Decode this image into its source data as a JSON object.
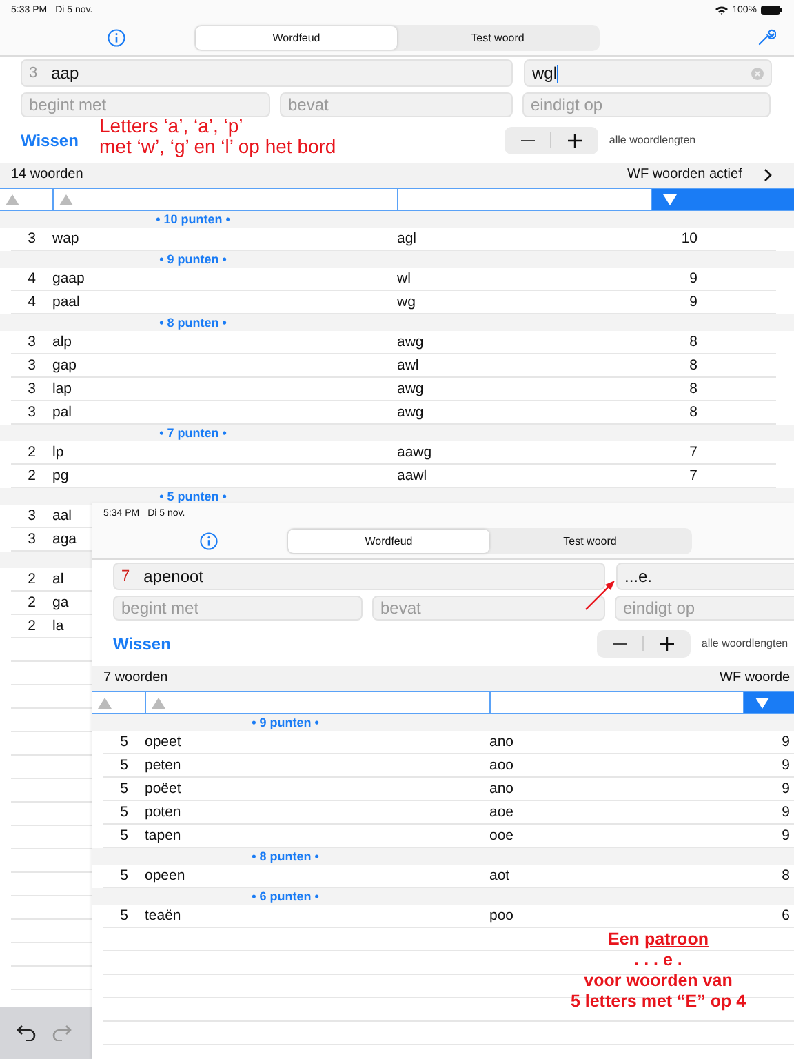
{
  "screens": [
    {
      "status_bar": {
        "time": "5:33 PM",
        "date": "Di 5 nov.",
        "battery": "100%"
      },
      "segments": [
        {
          "label": "Wordfeud",
          "selected": true
        },
        {
          "label": "Test woord",
          "selected": false
        }
      ],
      "letters_field": {
        "count": "3",
        "value": "aap",
        "alert": false
      },
      "board_field": {
        "value": "wgl",
        "focused": true
      },
      "filters": [
        {
          "placeholder": "begint met"
        },
        {
          "placeholder": "bevat"
        },
        {
          "placeholder": "eindigt op"
        }
      ],
      "clear_button": "Wissen",
      "length_label": "alle woordlengten",
      "result_count": "14 woorden",
      "wf_label": "WF woorden actief",
      "columns": [
        {
          "kind": "up",
          "selected": false
        },
        {
          "kind": "up",
          "selected": false
        },
        {
          "kind": "none",
          "selected": false
        },
        {
          "kind": "down",
          "selected": true
        }
      ],
      "rows": [
        {
          "kind": "section",
          "label": "• 10 punten •"
        },
        {
          "kind": "word",
          "length": "3",
          "word": "wap",
          "letters": "agl",
          "points": "10"
        },
        {
          "kind": "section",
          "label": "• 9 punten •"
        },
        {
          "kind": "word",
          "length": "4",
          "word": "gaap",
          "letters": "wl",
          "points": "9"
        },
        {
          "kind": "word",
          "length": "4",
          "word": "paal",
          "letters": "wg",
          "points": "9"
        },
        {
          "kind": "section",
          "label": "• 8 punten •"
        },
        {
          "kind": "word",
          "length": "3",
          "word": "alp",
          "letters": "awg",
          "points": "8"
        },
        {
          "kind": "word",
          "length": "3",
          "word": "gap",
          "letters": "awl",
          "points": "8"
        },
        {
          "kind": "word",
          "length": "3",
          "word": "lap",
          "letters": "awg",
          "points": "8"
        },
        {
          "kind": "word",
          "length": "3",
          "word": "pal",
          "letters": "awg",
          "points": "8"
        },
        {
          "kind": "section",
          "label": "• 7 punten •"
        },
        {
          "kind": "word",
          "length": "2",
          "word": "lp",
          "letters": "aawg",
          "points": "7"
        },
        {
          "kind": "word",
          "length": "2",
          "word": "pg",
          "letters": "aawl",
          "points": "7"
        },
        {
          "kind": "section",
          "label": "• 5 punten •"
        },
        {
          "kind": "word",
          "length": "3",
          "word": "aal"
        },
        {
          "kind": "word",
          "length": "3",
          "word": "aga"
        },
        {
          "kind": "section"
        },
        {
          "kind": "word",
          "length": "2",
          "word": "al"
        },
        {
          "kind": "word",
          "length": "2",
          "word": "ga"
        },
        {
          "kind": "word",
          "length": "2",
          "word": "la"
        }
      ],
      "annotation": "Letters ‘a’, ‘a’, ‘p’\nmet ‘w’, ‘g’ en ‘l’ op het bord",
      "edit_toolbar": true
    },
    {
      "status_bar": {
        "time": "5:34 PM",
        "date": "Di 5 nov."
      },
      "segments": [
        {
          "label": "Wordfeud",
          "selected": true
        },
        {
          "label": "Test woord",
          "selected": false
        }
      ],
      "letters_field": {
        "count": "7",
        "value": "apenoot",
        "alert": true
      },
      "board_field": {
        "value": "...e.",
        "focused": false
      },
      "filters": [
        {
          "placeholder": "begint met"
        },
        {
          "placeholder": "bevat"
        },
        {
          "placeholder": "eindigt op"
        }
      ],
      "clear_button": "Wissen",
      "length_label": "alle woordlengten",
      "result_count": "7 woorden",
      "wf_label": "WF woorde",
      "columns": [
        {
          "kind": "up",
          "selected": false
        },
        {
          "kind": "up",
          "selected": false
        },
        {
          "kind": "none",
          "selected": false
        },
        {
          "kind": "down",
          "selected": true
        }
      ],
      "rows": [
        {
          "kind": "section",
          "label": "• 9 punten •"
        },
        {
          "kind": "word",
          "length": "5",
          "word": "opeet",
          "letters": "ano",
          "points": "9"
        },
        {
          "kind": "word",
          "length": "5",
          "word": "peten",
          "letters": "aoo",
          "points": "9"
        },
        {
          "kind": "word",
          "length": "5",
          "word": "poëet",
          "letters": "ano",
          "points": "9"
        },
        {
          "kind": "word",
          "length": "5",
          "word": "poten",
          "letters": "aoe",
          "points": "9"
        },
        {
          "kind": "word",
          "length": "5",
          "word": "tapen",
          "letters": "ooe",
          "points": "9"
        },
        {
          "kind": "section",
          "label": "• 8 punten •"
        },
        {
          "kind": "word",
          "length": "5",
          "word": "opeen",
          "letters": "aot",
          "points": "8"
        },
        {
          "kind": "section",
          "label": "• 6 punten •"
        },
        {
          "kind": "word",
          "length": "5",
          "word": "teaën",
          "letters": "poo",
          "points": "6"
        }
      ]
    }
  ],
  "pattern_note": {
    "lead": "Een",
    "underlined": "patroon",
    "lines": [
      ". . . e .",
      "voor woorden  van",
      "5 letters met “E” op 4"
    ]
  }
}
